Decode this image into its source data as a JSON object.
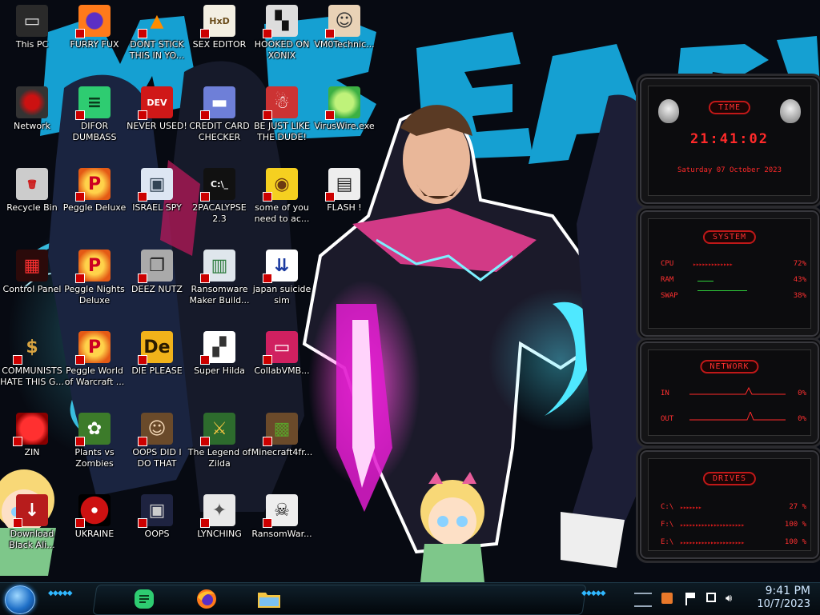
{
  "desktop": {
    "icons": [
      {
        "label": "This PC",
        "icon": "this-pc-icon"
      },
      {
        "label": "FURRY FUX",
        "icon": "firefox-icon"
      },
      {
        "label": "DONT STICK\nTHIS IN YO...",
        "icon": "vlc-icon"
      },
      {
        "label": "SEX EDITOR",
        "icon": "hxd-icon"
      },
      {
        "label": "HOOKED ON\nXONIX",
        "icon": "xonix-icon"
      },
      {
        "label": "VM0Technic...",
        "icon": "technician-icon"
      },
      {
        "label": "Network",
        "icon": "network-icon"
      },
      {
        "label": "DIFOR\nDUMBASS",
        "icon": "discord-icon"
      },
      {
        "label": "NEVER USED!",
        "icon": "devcpp-icon"
      },
      {
        "label": "CREDIT CARD\nCHECKER",
        "icon": "credit-card-icon"
      },
      {
        "label": "BE JUST LIKE\nTHE DUDE!",
        "icon": "dude-icon"
      },
      {
        "label": "VirusWire.exe",
        "icon": "lime-icon"
      },
      {
        "label": "Recycle Bin",
        "icon": "recycle-bin-icon"
      },
      {
        "label": "Peggle Deluxe",
        "icon": "peggle-icon"
      },
      {
        "label": "ISRAEL SPY",
        "icon": "spy-icon"
      },
      {
        "label": "2PACALYPSE\n2.3",
        "icon": "terminal-icon"
      },
      {
        "label": "some of you\nneed to ac...",
        "icon": "beaver-icon"
      },
      {
        "label": "FLASH !",
        "icon": "flash-icon"
      },
      {
        "label": "Control Panel",
        "icon": "control-panel-icon"
      },
      {
        "label": "Peggle Nights\nDeluxe",
        "icon": "peggle-icon"
      },
      {
        "label": "DEEZ NUTZ",
        "icon": "windows-stack-icon"
      },
      {
        "label": "Ransomware\nMaker Build...",
        "icon": "window-app-icon"
      },
      {
        "label": "japan suicide\nsim",
        "icon": "document-icon"
      },
      {
        "label": "COMMUNISTS\nHATE THIS G...",
        "icon": "money-bag-icon"
      },
      {
        "label": "Peggle World\nof Warcraft ...",
        "icon": "peggle-icon"
      },
      {
        "label": "DIE PLEASE",
        "icon": "de-icon"
      },
      {
        "label": "Super Hilda",
        "icon": "pixel-icon"
      },
      {
        "label": "CollabVMB...",
        "icon": "monitor-icon"
      },
      {
        "label": "ZIN",
        "icon": "red-blob-icon"
      },
      {
        "label": "Plants vs\nZombies",
        "icon": "plants-icon"
      },
      {
        "label": "OOPS DID I\nDO THAT",
        "icon": "portrait-icon"
      },
      {
        "label": "The Legend of\nZilda",
        "icon": "zelda-icon"
      },
      {
        "label": "Minecraft4fr...",
        "icon": "minecraft-icon"
      },
      {
        "label": "Download\nBlack Ali...",
        "icon": "download-icon"
      },
      {
        "label": "UKRAINE",
        "icon": "radiation-icon"
      },
      {
        "label": "OOPS",
        "icon": "oops-icon"
      },
      {
        "label": "LYNCHING",
        "icon": "lynching-icon"
      },
      {
        "label": "RansomWar...",
        "icon": "skull-icon"
      }
    ]
  },
  "wallpaper": {
    "text": "MrBeast"
  },
  "widgets": {
    "time": {
      "title": "TIME",
      "clock": "21:41:02",
      "date": "Saturday 07 October 2023"
    },
    "system": {
      "title": "SYSTEM",
      "rows": [
        {
          "name": "CPU",
          "pct": "72%"
        },
        {
          "name": "RAM",
          "pct": "43%"
        },
        {
          "name": "SWAP",
          "pct": "38%"
        }
      ]
    },
    "network": {
      "title": "NETWORK",
      "rows": [
        {
          "name": "IN",
          "pct": "0%"
        },
        {
          "name": "OUT",
          "pct": "0%"
        }
      ]
    },
    "drives": {
      "title": "DRIVES",
      "rows": [
        {
          "name": "C:\\",
          "pct": "27 %"
        },
        {
          "name": "F:\\",
          "pct": "100 %"
        },
        {
          "name": "E:\\",
          "pct": "100 %"
        }
      ]
    }
  },
  "taskbar": {
    "pinned": [
      {
        "name": "discord-pinned-button",
        "icon": "discord-icon"
      },
      {
        "name": "firefox-pinned-button",
        "icon": "firefox-icon"
      },
      {
        "name": "explorer-pinned-button",
        "icon": "folder-icon"
      }
    ],
    "tray_icons": [
      "network-adapter-icon",
      "flag-icon",
      "action-center-icon",
      "volume-icon"
    ],
    "time": "9:41 PM",
    "date": "10/7/2023"
  },
  "colors": {
    "accent_red": "#ff2a2a",
    "taskbar_text": "#cfe7ff",
    "wallpaper_cyan": "#18b7e8"
  }
}
